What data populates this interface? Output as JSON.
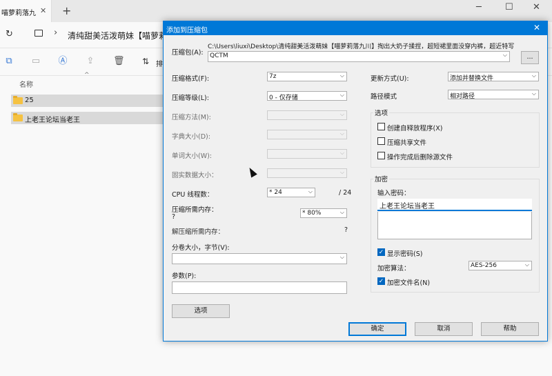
{
  "explorer": {
    "tab_title": "喵萝莉落九",
    "path": "清纯甜美活泼萌妹【喵萝莉",
    "sort_label": "排",
    "column_name": "名称",
    "rows": [
      "25",
      "上老王论坛当老王"
    ]
  },
  "dialog": {
    "title": "添加到压缩包",
    "archive_label": "压缩包(A):",
    "archive_path": "C:\\Users\\liuxi\\Desktop\\清纯甜美活泼萌妹【喵萝莉落九川】掏出大奶子揉捏，超短裙里面没穿内裤，超近特写",
    "archive_name": "QCTM",
    "browse_label": "...",
    "left": {
      "format_label": "压缩格式(F):",
      "format_value": "7z",
      "level_label": "压缩等级(L):",
      "level_value": "0 - 仅存储",
      "method_label": "压缩方法(M):",
      "dict_label": "字典大小(D):",
      "word_label": "单词大小(W):",
      "solid_label": "固实数据大小：",
      "cpu_label": "CPU 线程数：",
      "cpu_value": "* 24",
      "cpu_max": "/ 24",
      "mem_label": "压缩所需内存：",
      "mem_q": "?",
      "mem_value": "* 80%",
      "unmem_label": "解压缩所需内存：",
      "unmem_q": "?",
      "volume_label": "分卷大小，字节(V):",
      "params_label": "参数(P):",
      "options_button": "选项"
    },
    "right": {
      "update_label": "更新方式(U):",
      "update_value": "添加并替换文件",
      "pathmode_label": "路径模式",
      "pathmode_value": "相对路径",
      "options_group": "选项",
      "opt_sfx": "创建自释放程序(X)",
      "opt_shared": "压缩共享文件",
      "opt_delete": "操作完成后删除源文件",
      "enc_group": "加密",
      "pwd_label": "输入密码：",
      "pwd_value": "上老王论坛当老王",
      "show_pwd": "显示密码(S)",
      "enc_method_label": "加密算法：",
      "enc_method_value": "AES-256",
      "enc_names": "加密文件名(N)"
    },
    "buttons": {
      "ok": "确定",
      "cancel": "取消",
      "help": "帮助"
    }
  }
}
